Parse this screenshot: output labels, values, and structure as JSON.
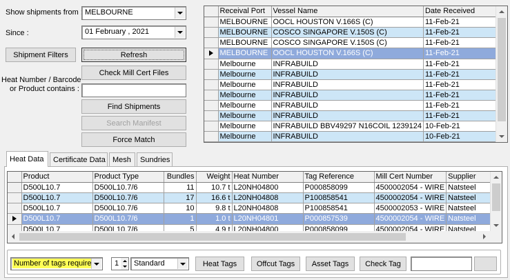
{
  "filters": {
    "show_from_label": "Show shipments from :",
    "show_from_value": "MELBOURNE",
    "since_label": "Since :",
    "since_value": "01   February  , 2021",
    "heat_label_line1": "Heat Number / Barcode",
    "heat_label_line2": "or Product contains :",
    "heat_value": ""
  },
  "buttons": {
    "shipment_filters": "Shipment Filters",
    "refresh": "Refresh",
    "check_mill_cert": "Check Mill Cert Files",
    "find_shipments": "Find Shipments",
    "search_manifest": "Search Manifest",
    "force_match": "Force Match"
  },
  "shipments": {
    "columns": [
      "Receival Port",
      "Vessel Name",
      "Date Received"
    ],
    "rows": [
      [
        "MELBOURNE",
        "OOCL HOUSTON V.166S (C)",
        "11-Feb-21"
      ],
      [
        "MELBOURNE",
        "COSCO SINGAPORE V.150S (C)",
        "11-Feb-21"
      ],
      [
        "MELBOURNE",
        "COSCO SINGAPORE V.150S (C)",
        "11-Feb-21"
      ],
      [
        "MELBOURNE",
        "OOCL HOUSTON V.166S (C)",
        "11-Feb-21"
      ],
      [
        "Melbourne",
        "INFRABUILD",
        "11-Feb-21"
      ],
      [
        "Melbourne",
        "INFRABUILD",
        "11-Feb-21"
      ],
      [
        "Melbourne",
        "INFRABUILD",
        "11-Feb-21"
      ],
      [
        "Melbourne",
        "INFRABUILD",
        "11-Feb-21"
      ],
      [
        "Melbourne",
        "INFRABUILD",
        "11-Feb-21"
      ],
      [
        "Melbourne",
        "INFRABUILD",
        "11-Feb-21"
      ],
      [
        "Melbourne",
        "INFRABUILD BBV49297 N16COIL 1239124",
        "10-Feb-21"
      ],
      [
        "Melbourne",
        "INFRABUILD",
        "10-Feb-21"
      ]
    ]
  },
  "tabs": [
    {
      "label": "Heat Data"
    },
    {
      "label": "Certificate Data"
    },
    {
      "label": "Mesh"
    },
    {
      "label": "Sundries"
    }
  ],
  "heat": {
    "columns": [
      "Product",
      "Product Type",
      "Bundles",
      "Weight",
      "Heat Number",
      "Tag Reference",
      "Mill Cert Number",
      "Supplier"
    ],
    "rows": [
      [
        "D500L10.7",
        "D500L10.7/6",
        "11",
        "10.7 t",
        "L20NH04800",
        "P000858099",
        "4500002054 - WIRE",
        "Natsteel"
      ],
      [
        "D500L10.7",
        "D500L10.7/6",
        "17",
        "16.6 t",
        "L20NH04808",
        "P100858541",
        "4500002054 - WIRE",
        "Natsteel"
      ],
      [
        "D500L10.7",
        "D500L10.7/6",
        "10",
        "9.8 t",
        "L20NH04808",
        "P100858541",
        "4500002053 - WIRE",
        "Natsteel"
      ],
      [
        "D500L10.7",
        "D500L10.7/6",
        "1",
        "1.0 t",
        "L20NH04801",
        "P000857539",
        "4500002054 - WIRE",
        "Natsteel"
      ],
      [
        "D500L10.7",
        "D500L10.7/6",
        "5",
        "4.9 t",
        "L20NH04800",
        "P000858099",
        "4500002054 - WIRE",
        "Natsteel"
      ]
    ]
  },
  "tagbar": {
    "tags_required_label": "Number of tags required",
    "quantity": "1",
    "format": "Standard",
    "heat_tags": "Heat Tags",
    "offcut_tags": "Offcut Tags",
    "asset_tags": "Asset Tags",
    "check_tag": "Check Tag",
    "check_tag_input": ""
  },
  "colors": {
    "row_blue": "#cde6f7",
    "row_selected": "#8faadc",
    "highlight_yellow": "#ffff55"
  }
}
